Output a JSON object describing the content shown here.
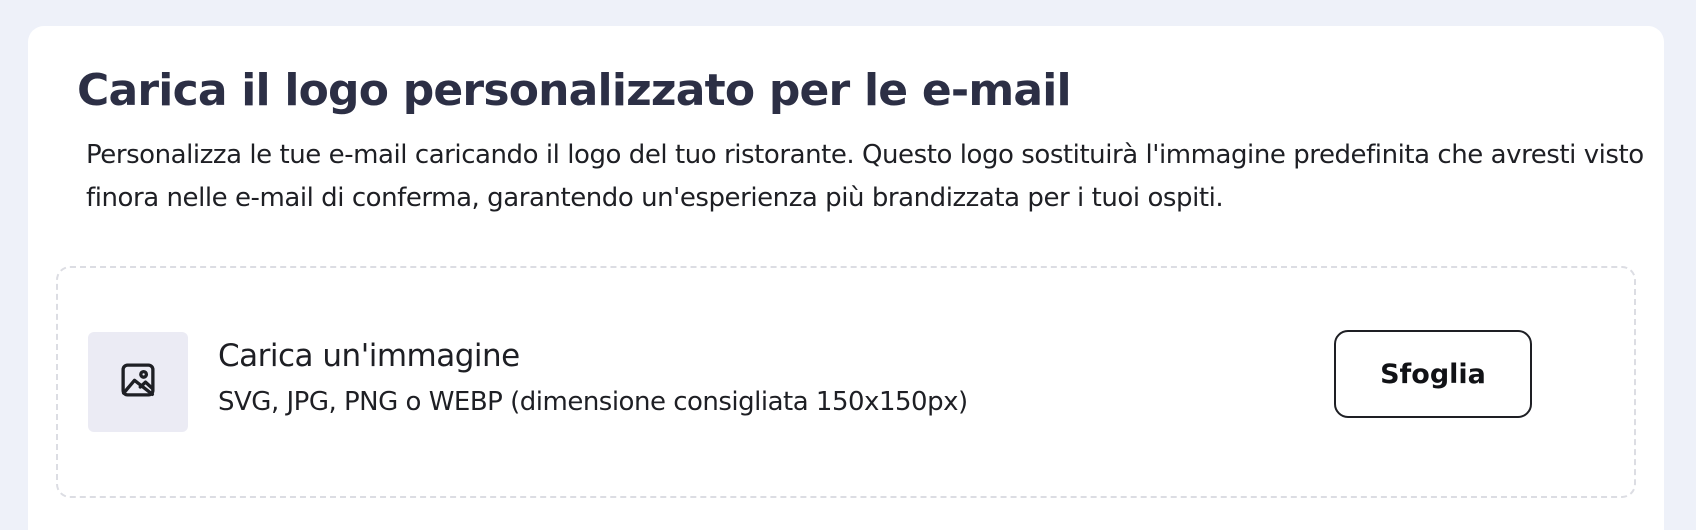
{
  "logo_upload": {
    "title": "Carica il logo personalizzato per le e-mail",
    "description": "Personalizza le tue e-mail caricando il logo del tuo ristorante. Questo logo sostituirà l'immagine predefinita che avresti visto finora nelle e-mail di conferma, garantendo un'esperienza più brandizzata per i tuoi ospiti.",
    "dropzone": {
      "icon": "image-icon",
      "title": "Carica un'immagine",
      "hint": "SVG, JPG, PNG o WEBP (dimensione consigliata 150x150px)",
      "browse_label": "Sfoglia"
    }
  },
  "colors": {
    "page_background": "#eef1f9",
    "card_background": "#ffffff",
    "heading": "#2c2f45",
    "text": "#1e1f24",
    "thumb_background": "#ebebf4",
    "dropzone_border": "#dcdde3"
  }
}
